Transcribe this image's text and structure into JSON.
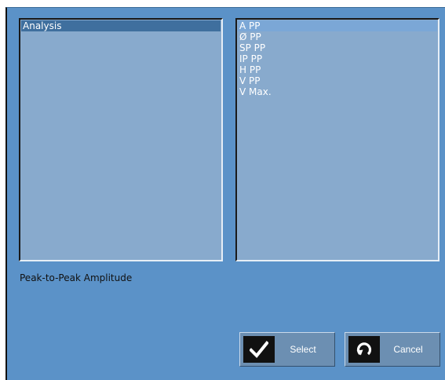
{
  "left_list": {
    "items": [
      {
        "label": "Analysis",
        "selected": true
      }
    ]
  },
  "right_list": {
    "items": [
      {
        "label": "A PP",
        "selected": true
      },
      {
        "label": "Ø PP",
        "selected": false
      },
      {
        "label": "SP PP",
        "selected": false
      },
      {
        "label": "IP PP",
        "selected": false
      },
      {
        "label": "H PP",
        "selected": false
      },
      {
        "label": "V PP",
        "selected": false
      },
      {
        "label": "V Max.",
        "selected": false
      }
    ]
  },
  "description": "Peak-to-Peak Amplitude",
  "buttons": {
    "select_label": "Select",
    "cancel_label": "Cancel"
  },
  "icons": {
    "select": "checkmark-icon",
    "cancel": "undo-icon"
  },
  "colors": {
    "dialog_background": "#5b92c8",
    "list_background": "#88aacd",
    "selection_dark": "#3f6f9e",
    "selection_light": "#7ba7d6"
  }
}
